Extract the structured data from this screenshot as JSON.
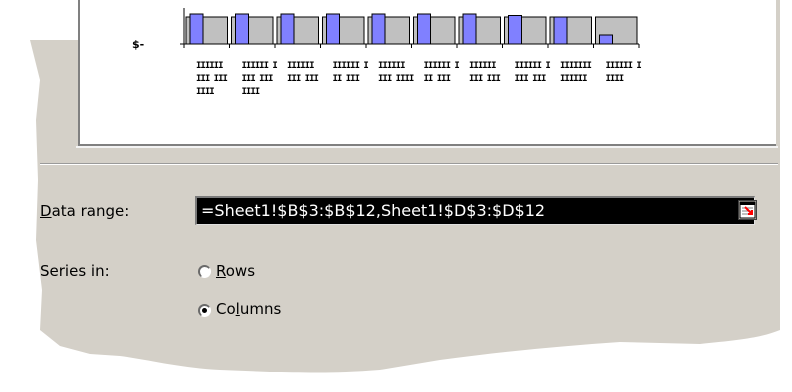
{
  "chart_data": {
    "type": "bar",
    "series": [
      {
        "values": [
          20,
          20,
          20,
          20,
          20,
          20,
          20,
          19,
          18,
          6
        ]
      },
      {
        "values": [
          18,
          18,
          18,
          18,
          18,
          18,
          18,
          18,
          18,
          18
        ]
      }
    ],
    "tick_labels": [
      "$-"
    ],
    "colors": {
      "series1": "#8080ff",
      "series2": "#c0c0c0"
    }
  },
  "category_labels": [
    [
      "IIIIII",
      "III III",
      "IIII"
    ],
    [
      "IIIIII I",
      "III III",
      "IIII"
    ],
    [
      "IIIIII",
      "III III",
      ""
    ],
    [
      "IIIIII I",
      "II III",
      ""
    ],
    [
      "IIIIII",
      "III IIII",
      ""
    ],
    [
      "IIIIII I",
      "II III",
      ""
    ],
    [
      "IIIIII",
      "III III",
      ""
    ],
    [
      "IIIIII I",
      "III III",
      ""
    ],
    [
      "IIIIIII",
      "IIIIII",
      ""
    ],
    [
      "IIIIII I",
      "IIII",
      ""
    ]
  ],
  "form": {
    "data_range_label_first": "D",
    "data_range_label_rest": "ata range:",
    "data_range_value": "=Sheet1!$B$3:$B$12,Sheet1!$D$3:$D$12",
    "series_in_label": "Series in:",
    "rows_first": "R",
    "rows_rest": "ows",
    "columns_pre": "Co",
    "columns_u": "l",
    "columns_post": "umns"
  },
  "colors": {
    "dialog_face": "#d4d0c8"
  }
}
